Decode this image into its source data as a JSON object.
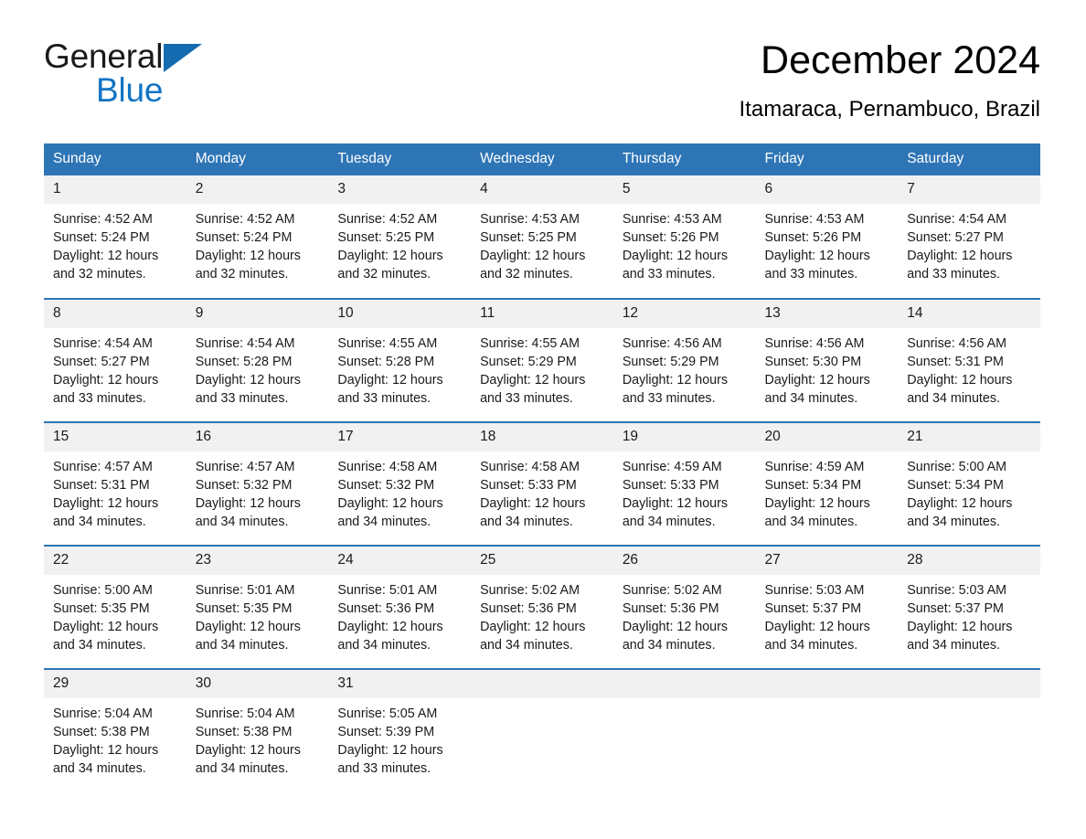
{
  "brand": {
    "name_part1": "General",
    "name_part2": "Blue",
    "triangle_icon": "triangle-icon",
    "accent_color": "#156BAF",
    "blue_text_color": "#1274C4"
  },
  "header": {
    "month_title": "December 2024",
    "location": "Itamaraca, Pernambuco, Brazil"
  },
  "calendar": {
    "header_bg_color": "#2E75B6",
    "daynum_bg_color": "#F1F1F1",
    "row_border_color": "#2E75B6",
    "weekday_headers": [
      "Sunday",
      "Monday",
      "Tuesday",
      "Wednesday",
      "Thursday",
      "Friday",
      "Saturday"
    ],
    "weeks": [
      [
        {
          "day": "1",
          "sunrise": "Sunrise: 4:52 AM",
          "sunset": "Sunset: 5:24 PM",
          "daylight": "Daylight: 12 hours and 32 minutes."
        },
        {
          "day": "2",
          "sunrise": "Sunrise: 4:52 AM",
          "sunset": "Sunset: 5:24 PM",
          "daylight": "Daylight: 12 hours and 32 minutes."
        },
        {
          "day": "3",
          "sunrise": "Sunrise: 4:52 AM",
          "sunset": "Sunset: 5:25 PM",
          "daylight": "Daylight: 12 hours and 32 minutes."
        },
        {
          "day": "4",
          "sunrise": "Sunrise: 4:53 AM",
          "sunset": "Sunset: 5:25 PM",
          "daylight": "Daylight: 12 hours and 32 minutes."
        },
        {
          "day": "5",
          "sunrise": "Sunrise: 4:53 AM",
          "sunset": "Sunset: 5:26 PM",
          "daylight": "Daylight: 12 hours and 33 minutes."
        },
        {
          "day": "6",
          "sunrise": "Sunrise: 4:53 AM",
          "sunset": "Sunset: 5:26 PM",
          "daylight": "Daylight: 12 hours and 33 minutes."
        },
        {
          "day": "7",
          "sunrise": "Sunrise: 4:54 AM",
          "sunset": "Sunset: 5:27 PM",
          "daylight": "Daylight: 12 hours and 33 minutes."
        }
      ],
      [
        {
          "day": "8",
          "sunrise": "Sunrise: 4:54 AM",
          "sunset": "Sunset: 5:27 PM",
          "daylight": "Daylight: 12 hours and 33 minutes."
        },
        {
          "day": "9",
          "sunrise": "Sunrise: 4:54 AM",
          "sunset": "Sunset: 5:28 PM",
          "daylight": "Daylight: 12 hours and 33 minutes."
        },
        {
          "day": "10",
          "sunrise": "Sunrise: 4:55 AM",
          "sunset": "Sunset: 5:28 PM",
          "daylight": "Daylight: 12 hours and 33 minutes."
        },
        {
          "day": "11",
          "sunrise": "Sunrise: 4:55 AM",
          "sunset": "Sunset: 5:29 PM",
          "daylight": "Daylight: 12 hours and 33 minutes."
        },
        {
          "day": "12",
          "sunrise": "Sunrise: 4:56 AM",
          "sunset": "Sunset: 5:29 PM",
          "daylight": "Daylight: 12 hours and 33 minutes."
        },
        {
          "day": "13",
          "sunrise": "Sunrise: 4:56 AM",
          "sunset": "Sunset: 5:30 PM",
          "daylight": "Daylight: 12 hours and 34 minutes."
        },
        {
          "day": "14",
          "sunrise": "Sunrise: 4:56 AM",
          "sunset": "Sunset: 5:31 PM",
          "daylight": "Daylight: 12 hours and 34 minutes."
        }
      ],
      [
        {
          "day": "15",
          "sunrise": "Sunrise: 4:57 AM",
          "sunset": "Sunset: 5:31 PM",
          "daylight": "Daylight: 12 hours and 34 minutes."
        },
        {
          "day": "16",
          "sunrise": "Sunrise: 4:57 AM",
          "sunset": "Sunset: 5:32 PM",
          "daylight": "Daylight: 12 hours and 34 minutes."
        },
        {
          "day": "17",
          "sunrise": "Sunrise: 4:58 AM",
          "sunset": "Sunset: 5:32 PM",
          "daylight": "Daylight: 12 hours and 34 minutes."
        },
        {
          "day": "18",
          "sunrise": "Sunrise: 4:58 AM",
          "sunset": "Sunset: 5:33 PM",
          "daylight": "Daylight: 12 hours and 34 minutes."
        },
        {
          "day": "19",
          "sunrise": "Sunrise: 4:59 AM",
          "sunset": "Sunset: 5:33 PM",
          "daylight": "Daylight: 12 hours and 34 minutes."
        },
        {
          "day": "20",
          "sunrise": "Sunrise: 4:59 AM",
          "sunset": "Sunset: 5:34 PM",
          "daylight": "Daylight: 12 hours and 34 minutes."
        },
        {
          "day": "21",
          "sunrise": "Sunrise: 5:00 AM",
          "sunset": "Sunset: 5:34 PM",
          "daylight": "Daylight: 12 hours and 34 minutes."
        }
      ],
      [
        {
          "day": "22",
          "sunrise": "Sunrise: 5:00 AM",
          "sunset": "Sunset: 5:35 PM",
          "daylight": "Daylight: 12 hours and 34 minutes."
        },
        {
          "day": "23",
          "sunrise": "Sunrise: 5:01 AM",
          "sunset": "Sunset: 5:35 PM",
          "daylight": "Daylight: 12 hours and 34 minutes."
        },
        {
          "day": "24",
          "sunrise": "Sunrise: 5:01 AM",
          "sunset": "Sunset: 5:36 PM",
          "daylight": "Daylight: 12 hours and 34 minutes."
        },
        {
          "day": "25",
          "sunrise": "Sunrise: 5:02 AM",
          "sunset": "Sunset: 5:36 PM",
          "daylight": "Daylight: 12 hours and 34 minutes."
        },
        {
          "day": "26",
          "sunrise": "Sunrise: 5:02 AM",
          "sunset": "Sunset: 5:36 PM",
          "daylight": "Daylight: 12 hours and 34 minutes."
        },
        {
          "day": "27",
          "sunrise": "Sunrise: 5:03 AM",
          "sunset": "Sunset: 5:37 PM",
          "daylight": "Daylight: 12 hours and 34 minutes."
        },
        {
          "day": "28",
          "sunrise": "Sunrise: 5:03 AM",
          "sunset": "Sunset: 5:37 PM",
          "daylight": "Daylight: 12 hours and 34 minutes."
        }
      ],
      [
        {
          "day": "29",
          "sunrise": "Sunrise: 5:04 AM",
          "sunset": "Sunset: 5:38 PM",
          "daylight": "Daylight: 12 hours and 34 minutes."
        },
        {
          "day": "30",
          "sunrise": "Sunrise: 5:04 AM",
          "sunset": "Sunset: 5:38 PM",
          "daylight": "Daylight: 12 hours and 34 minutes."
        },
        {
          "day": "31",
          "sunrise": "Sunrise: 5:05 AM",
          "sunset": "Sunset: 5:39 PM",
          "daylight": "Daylight: 12 hours and 33 minutes."
        },
        {
          "day": "",
          "sunrise": "",
          "sunset": "",
          "daylight": ""
        },
        {
          "day": "",
          "sunrise": "",
          "sunset": "",
          "daylight": ""
        },
        {
          "day": "",
          "sunrise": "",
          "sunset": "",
          "daylight": ""
        },
        {
          "day": "",
          "sunrise": "",
          "sunset": "",
          "daylight": ""
        }
      ]
    ]
  }
}
